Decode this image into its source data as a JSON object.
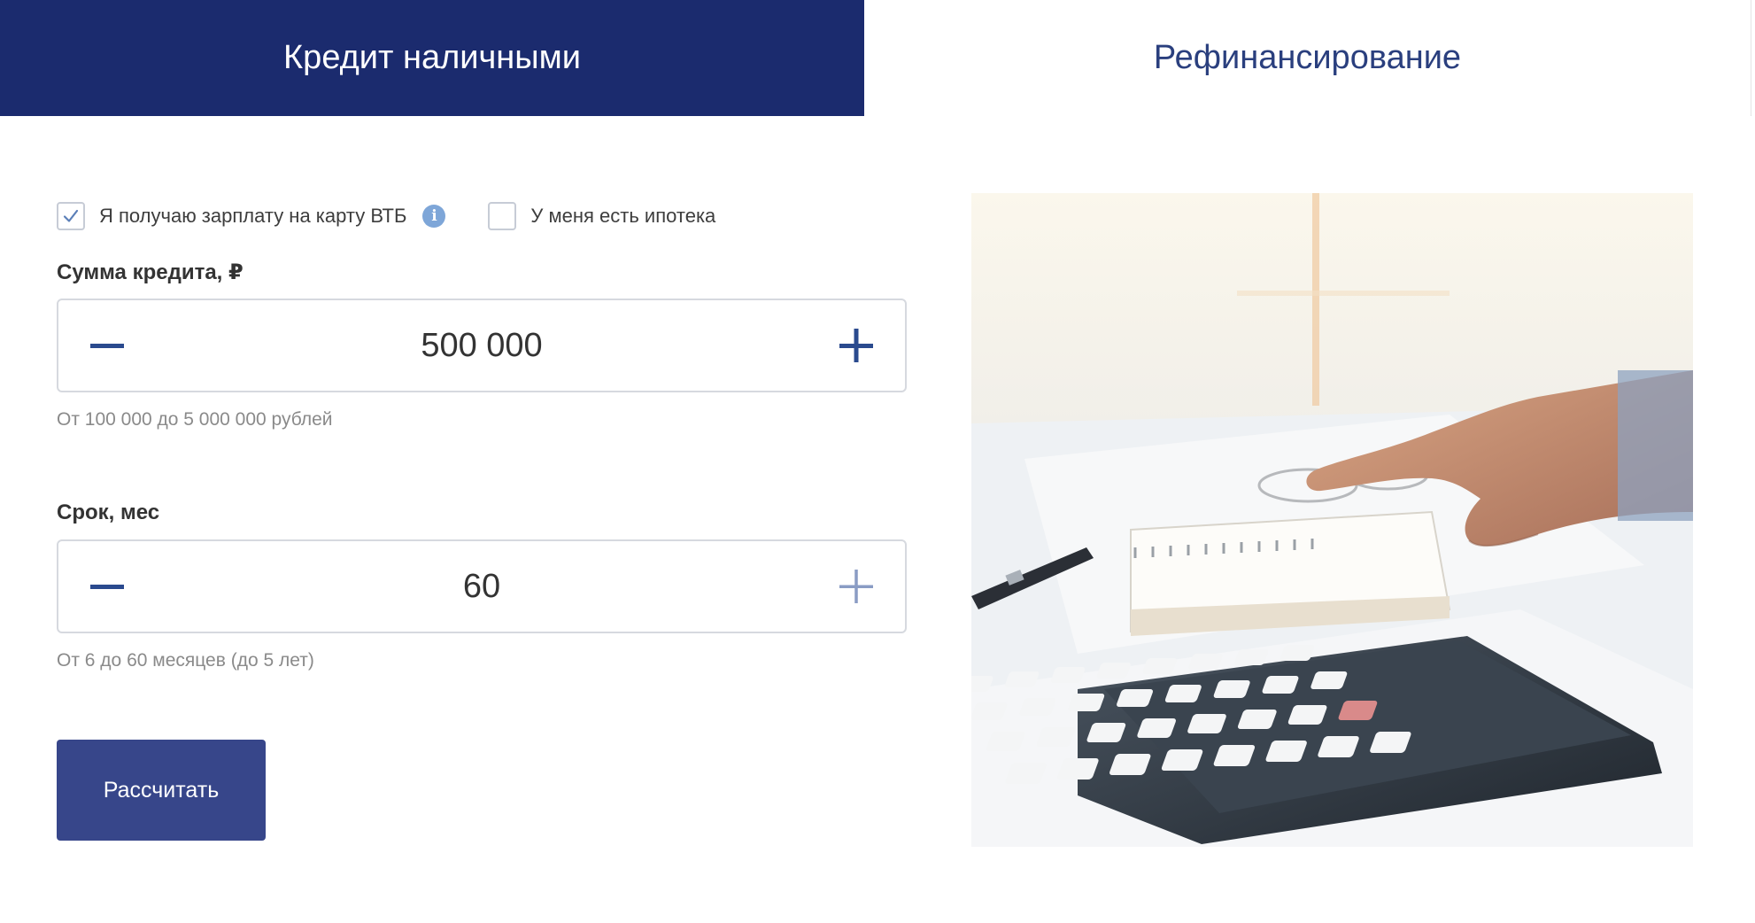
{
  "tabs": {
    "cash_credit": "Кредит наличными",
    "refinancing": "Рефинансирование"
  },
  "options": {
    "salary_card": {
      "label": "Я получаю зарплату на карту ВТБ",
      "checked": true
    },
    "mortgage": {
      "label": "У меня есть ипотека",
      "checked": false
    },
    "info_icon_glyph": "i"
  },
  "amount": {
    "label": "Сумма кредита, ₽",
    "value": "500 000",
    "hint": "От 100 000 до 5 000 000 рублей"
  },
  "term": {
    "label": "Срок, мес",
    "value": "60",
    "hint": "От 6 до 60 месяцев (до 5 лет)"
  },
  "submit_label": "Рассчитать",
  "colors": {
    "brand_navy": "#1b2b6e",
    "button": "#37468a",
    "accent_blue": "#2a4a8e",
    "info": "#7ea6d8"
  },
  "icons": {
    "minus": "minus-icon",
    "plus": "plus-icon",
    "check": "check-icon",
    "info": "info-icon"
  }
}
